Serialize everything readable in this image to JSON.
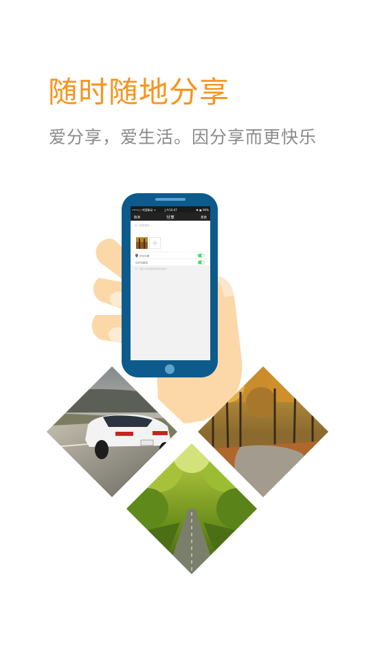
{
  "headline": "随时随地分享",
  "subline": "爱分享，爱生活。因分享而更快乐",
  "colors": {
    "accent": "#f7941d",
    "subtext": "#8a8a8a",
    "phone_body": "#0d5b8c",
    "screen_bg": "#f2f2f2",
    "nav_bar": "#222222",
    "toggle_on": "#4cd964",
    "skin": "#fcd8a8"
  },
  "phone": {
    "status_bar": {
      "carrier": "••••○ 中国移动 ᯤ",
      "time": "上午10:47",
      "battery": "✱ ▣ 90%"
    },
    "nav": {
      "back_label": "取消",
      "title": "分享",
      "action_label": "发表"
    },
    "compose_placeholder": "这一刻的想法...",
    "add_photo_symbol": "+",
    "location_label": "所在位置",
    "option_label": "同步到微博",
    "note": "一起分享的内容将出现在动态中"
  },
  "photos": [
    {
      "name": "car-on-road-photo"
    },
    {
      "name": "autumn-forest-road-photo"
    },
    {
      "name": "green-tree-lane-photo"
    }
  ]
}
